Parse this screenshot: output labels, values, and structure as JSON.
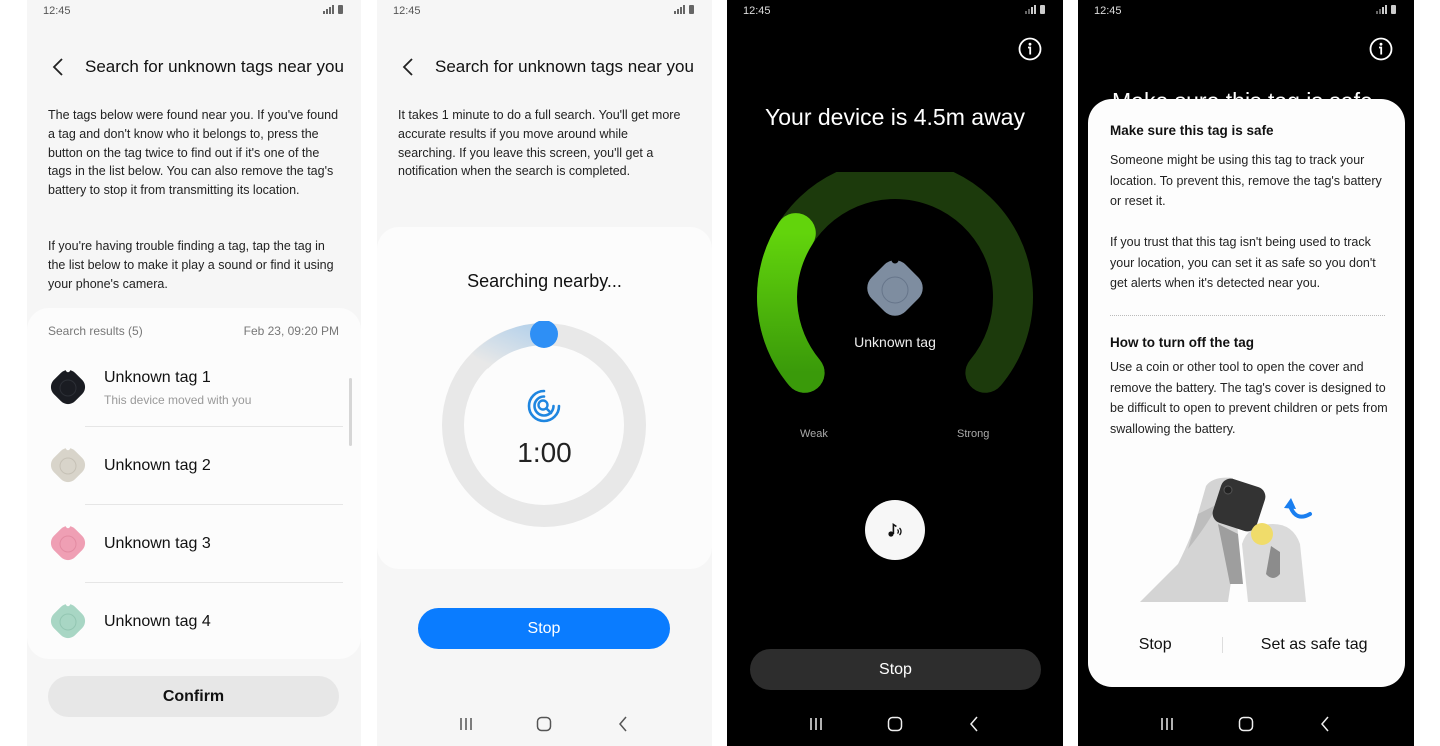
{
  "status_bar": {
    "time": "12:45"
  },
  "screen1": {
    "title": "Search for unknown tags near you",
    "description_1": "The tags below were found near you. If you've found a tag and don't know who it belongs to, press the button on the tag twice to find out if it's one of the tags in the list below. You can also remove the tag's battery to stop it from transmitting its location.",
    "description_2": "If you're having trouble finding a tag, tap the tag in the list below to make it play a sound or find it using your phone's camera.",
    "results_label": "Search results (5)",
    "results_timestamp": "Feb 23, 09:20 PM",
    "tags": [
      {
        "name": "Unknown tag 1",
        "subtitle": "This device moved with you",
        "color": "#1a1c22"
      },
      {
        "name": "Unknown tag 2",
        "subtitle": "",
        "color": "#d8d4ca"
      },
      {
        "name": "Unknown tag 3",
        "subtitle": "",
        "color": "#ef9fb4"
      },
      {
        "name": "Unknown tag 4",
        "subtitle": "",
        "color": "#a8d6c4"
      }
    ],
    "confirm_label": "Confirm"
  },
  "screen2": {
    "title": "Search for unknown tags near you",
    "description": "It takes 1 minute to do a full search. You'll get more accurate results if you move around while searching. If you leave this screen, you'll get a notification when the search is completed.",
    "searching_label": "Searching nearby...",
    "timer": "1:00",
    "stop_label": "Stop",
    "accent": "#0a7cff"
  },
  "screen3": {
    "distance_text": "Your device is 4.5m away",
    "tag_label": "Unknown tag",
    "weak_label": "Weak",
    "strong_label": "Strong",
    "signal_strength_fraction": 0.28,
    "stop_label": "Stop",
    "gauge_active_color": "#5bd10a",
    "gauge_track_color": "#1c3a0c"
  },
  "screen4": {
    "behind_title": "Make sure this tag is safe",
    "section1_title": "Make sure this tag is safe",
    "section1_p1": "Someone might be using this tag to track your location. To prevent this, remove the tag's battery or reset it.",
    "section1_p2": "If you trust that this tag isn't being used to track your location, you can set it as safe so you don't get alerts when it's detected near you.",
    "section2_title": "How to turn off the tag",
    "section2_p": "Use a coin or other tool to open the cover and remove the battery. The tag's cover is designed to be difficult to open to prevent children or pets from swallowing the battery.",
    "stop_label": "Stop",
    "safe_label": "Set as safe tag"
  }
}
